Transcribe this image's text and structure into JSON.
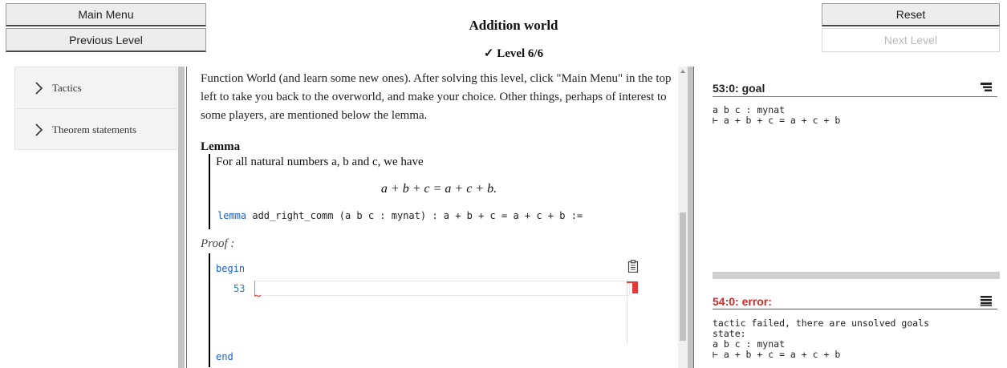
{
  "header": {
    "main_menu": "Main Menu",
    "previous_level": "Previous Level",
    "world_title": "Addition world",
    "level_label": "✓ Level 6/6",
    "reset": "Reset",
    "next_level": "Next Level"
  },
  "sidebar": {
    "items": [
      {
        "label": "Tactics"
      },
      {
        "label": "Theorem statements"
      }
    ]
  },
  "content": {
    "intro": "Function World (and learn some new ones). After solving this level, click \"Main Menu\" in the top left to take you back to the overworld, and make your choice. Other things, perhaps of interest to some players, are mentioned below the lemma.",
    "lemma_heading": "Lemma",
    "lemma_statement": "For all natural numbers a, b and c, we have",
    "lemma_equation": "a + b + c = a + c + b.",
    "lemma_keyword": "lemma",
    "lemma_code": " add_right_comm (a b c : mynat) : a + b + c = a + c + b :=",
    "proof_label": "Proof :",
    "proof_begin": "begin",
    "proof_end": "end",
    "editor_line_number": "53",
    "editor_line_value": ""
  },
  "goal_pane": {
    "title": "53:0: goal",
    "text": "a b c : mynat\n⊢ a + b + c = a + c + b"
  },
  "error_pane": {
    "title": "54:0: error:",
    "text": "tactic failed, there are unsolved goals\nstate:\na b c : mynat\n⊢ a + b + c = a + c + b"
  },
  "colors": {
    "keyword": "#1b5fd1",
    "error": "#d02a2a",
    "line_number": "#2a7da8"
  }
}
